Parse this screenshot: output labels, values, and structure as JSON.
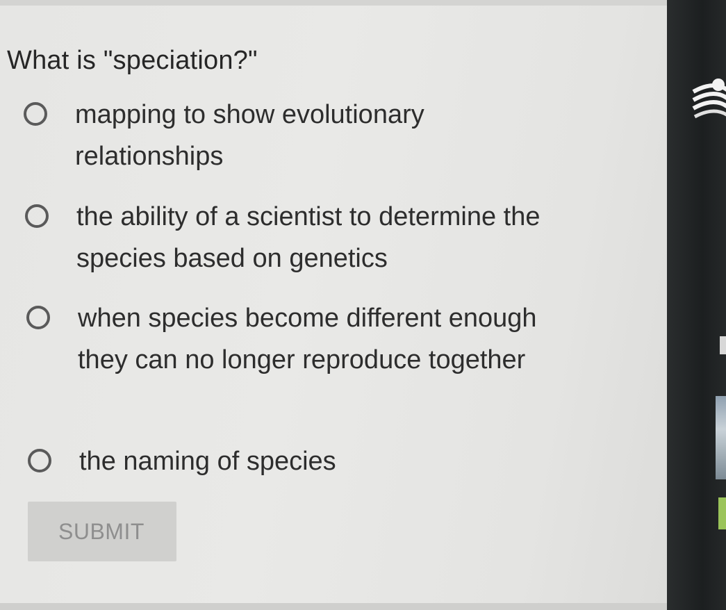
{
  "quiz": {
    "question": "What is \"speciation?\"",
    "options": [
      {
        "label": "mapping to show evolutionary relationships",
        "selected": false
      },
      {
        "label": "the ability of a scientist to determine the species based on genetics",
        "selected": false
      },
      {
        "label": "when species become different enough they can no longer reproduce together",
        "selected": false
      },
      {
        "label": "the naming of species",
        "selected": false
      }
    ],
    "submit_label": "SUBMIT"
  },
  "icons": {
    "bezel_icon": "wifi-icon"
  },
  "colors": {
    "background": "#e6e6e4",
    "text": "#2d2d2d",
    "radio_border": "#5a5a5a",
    "submit_bg": "#d0d0ce",
    "submit_text": "#8e8e8e",
    "bezel": "#1f2223"
  }
}
